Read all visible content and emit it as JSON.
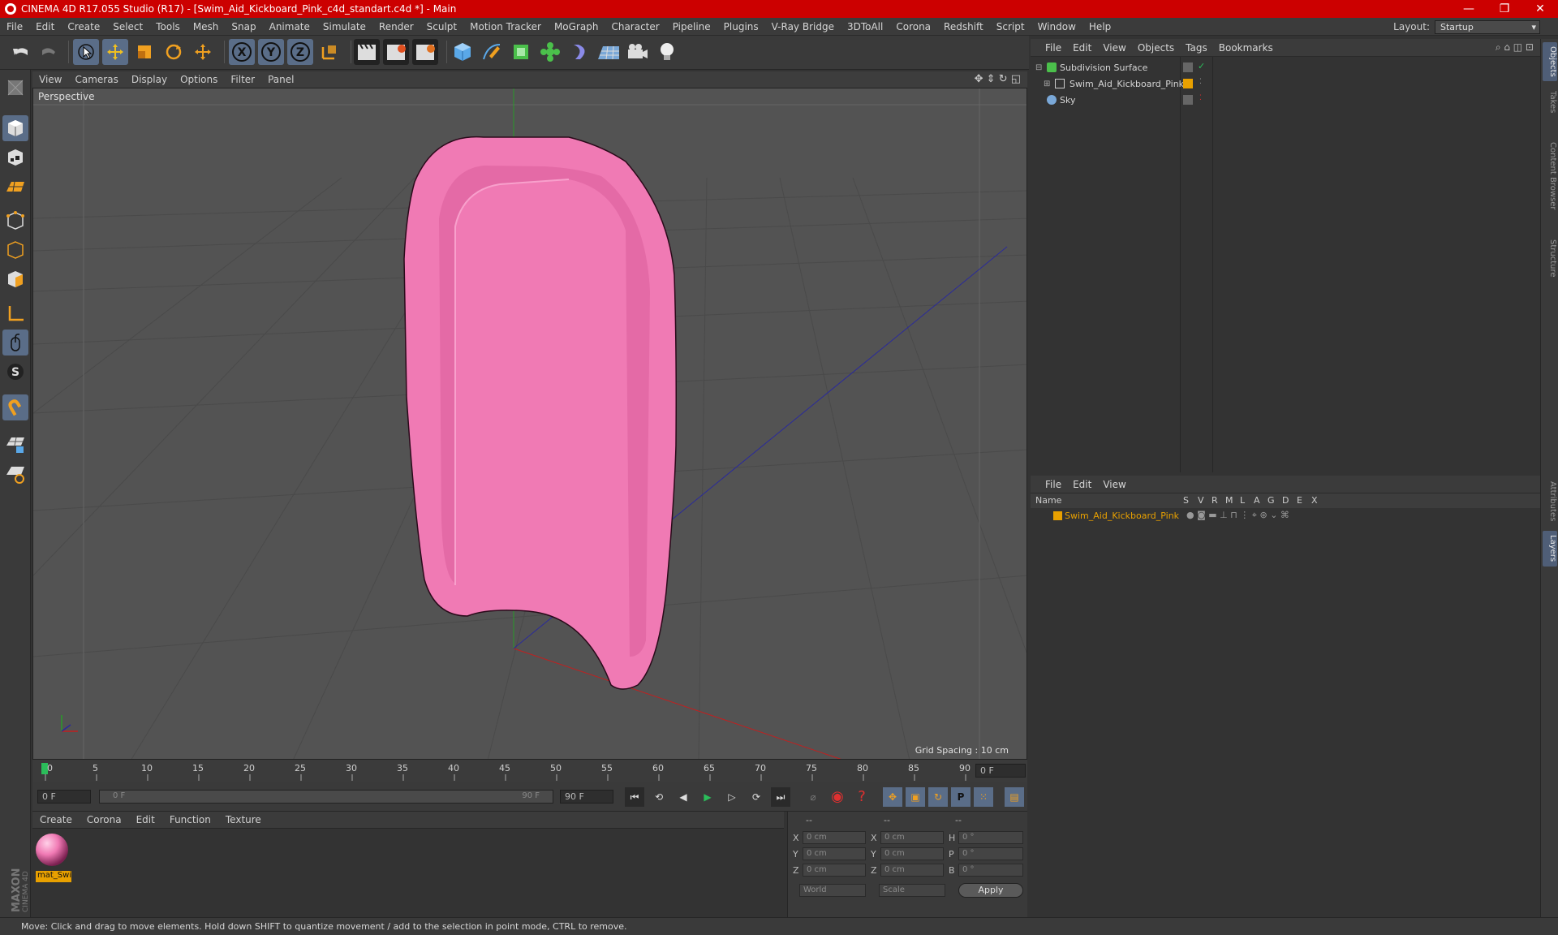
{
  "window": {
    "title": "CINEMA 4D R17.055 Studio (R17) - [Swim_Aid_Kickboard_Pink_c4d_standart.c4d *] - Main",
    "minimize": "—",
    "maximize": "❐",
    "close": "✕"
  },
  "menubar": {
    "items": [
      "File",
      "Edit",
      "Create",
      "Select",
      "Tools",
      "Mesh",
      "Snap",
      "Animate",
      "Simulate",
      "Render",
      "Sculpt",
      "Motion Tracker",
      "MoGraph",
      "Character",
      "Pipeline",
      "Plugins",
      "V-Ray Bridge",
      "3DToAll",
      "Corona",
      "Redshift",
      "Script",
      "Window",
      "Help"
    ],
    "layout_label": "Layout:",
    "layout_value": "Startup"
  },
  "viewport": {
    "menu": [
      "View",
      "Cameras",
      "Display",
      "Options",
      "Filter",
      "Panel"
    ],
    "label": "Perspective",
    "grid_spacing": "Grid Spacing : 10 cm",
    "object_color": "#f07ab4"
  },
  "timeline": {
    "ticks": [
      "0",
      "5",
      "10",
      "15",
      "20",
      "25",
      "30",
      "35",
      "40",
      "45",
      "50",
      "55",
      "60",
      "65",
      "70",
      "75",
      "80",
      "85",
      "90"
    ],
    "frame_field": "0 F"
  },
  "transport": {
    "start_field": "0 F",
    "range_start": "0 F",
    "range_end": "90 F",
    "end_field": "90 F"
  },
  "material_manager": {
    "menu": [
      "Create",
      "Corona",
      "Edit",
      "Function",
      "Texture"
    ],
    "material_name": "mat_Swi"
  },
  "coordinates": {
    "headers": [
      "--",
      "--",
      "--"
    ],
    "rows": [
      {
        "a": "X",
        "av": "0 cm",
        "b": "X",
        "bv": "0 cm",
        "c": "H",
        "cv": "0 °"
      },
      {
        "a": "Y",
        "av": "0 cm",
        "b": "Y",
        "bv": "0 cm",
        "c": "P",
        "cv": "0 °"
      },
      {
        "a": "Z",
        "av": "0 cm",
        "b": "Z",
        "bv": "0 cm",
        "c": "B",
        "cv": "0 °"
      }
    ],
    "world": "World",
    "scale": "Scale",
    "apply": "Apply"
  },
  "object_manager": {
    "menu": [
      "File",
      "Edit",
      "View",
      "Objects",
      "Tags",
      "Bookmarks"
    ],
    "objects": [
      {
        "name": "Subdivision Surface"
      },
      {
        "name": "Swim_Aid_Kickboard_Pink"
      },
      {
        "name": "Sky"
      }
    ]
  },
  "layer_manager": {
    "menu": [
      "File",
      "Edit",
      "View"
    ],
    "columns": [
      "Name",
      "S",
      "V",
      "R",
      "M",
      "L",
      "A",
      "G",
      "D",
      "E",
      "X"
    ],
    "layers": [
      {
        "name": "Swim_Aid_Kickboard_Pink",
        "color": "#e8a000"
      }
    ]
  },
  "right_tabs": [
    "Objects",
    "Takes",
    "Content Browser",
    "Structure",
    "Attributes",
    "Layers"
  ],
  "status": "Move: Click and drag to move elements. Hold down SHIFT to quantize movement / add to the selection in point mode, CTRL to remove.",
  "brand": "MAXON CINEMA 4D"
}
